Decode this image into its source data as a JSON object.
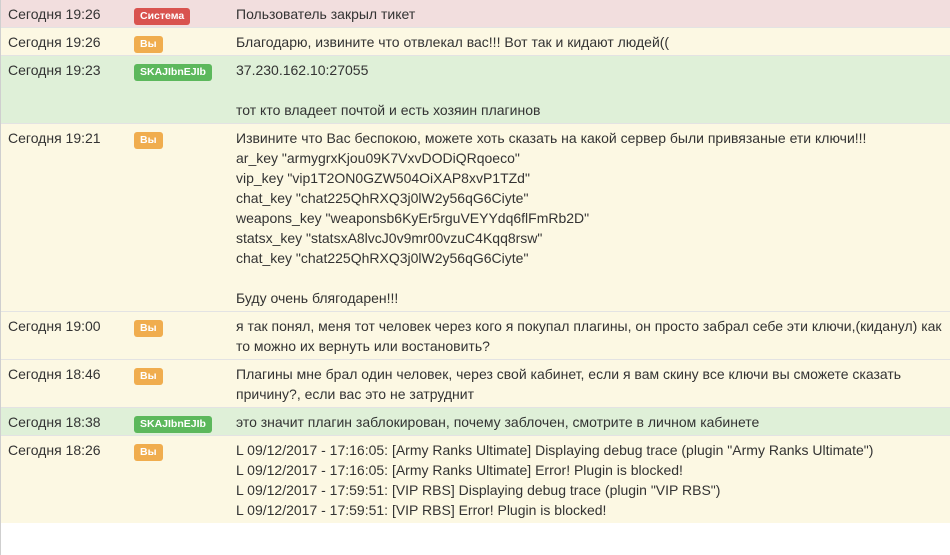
{
  "messages": [
    {
      "time": "Сегодня 19:26",
      "author": "Система",
      "role": "system",
      "lines": [
        "Пользователь закрыл тикет"
      ]
    },
    {
      "time": "Сегодня 19:26",
      "author": "Вы",
      "role": "user",
      "lines": [
        "Благодарю, извините что отвлекал вас!!! Вот так и кидают людей(("
      ]
    },
    {
      "time": "Сегодня 19:23",
      "author": "SKAJIbnEJIb",
      "role": "staff",
      "lines": [
        "37.230.162.10:27055",
        "",
        "тот кто владеет почтой и есть хозяин плагинов"
      ]
    },
    {
      "time": "Сегодня 19:21",
      "author": "Вы",
      "role": "user",
      "lines": [
        "Извините что Вас беспокою, можете хоть сказать на какой сервер были привязаные ети ключи!!!",
        "ar_key \"armygrxKjou09K7VxvDODiQRqoeco\"",
        "vip_key \"vip1T2ON0GZW504OiXAP8xvP1TZd\"",
        "chat_key \"chat225QhRXQ3j0lW2y56qG6Ciyte\"",
        "weapons_key \"weaponsb6KyEr5rguVEYYdq6flFmRb2D\"",
        "statsx_key \"statsxA8lvcJ0v9mr00vzuC4Kqq8rsw\"",
        "chat_key \"chat225QhRXQ3j0lW2y56qG6Ciyte\"",
        "",
        "Буду очень блягодарен!!!"
      ]
    },
    {
      "time": "Сегодня 19:00",
      "author": "Вы",
      "role": "user",
      "lines": [
        "я так понял, меня тот человек через кого я покупал плагины, он просто забрал себе эти ключи,(киданул) как",
        "то можно их вернуть или востановить?"
      ]
    },
    {
      "time": "Сегодня 18:46",
      "author": "Вы",
      "role": "user",
      "lines": [
        "Плагины мне брал один человек, через свой кабинет, если я вам скину все ключи вы сможете сказать",
        "причину?, если вас это не затруднит"
      ]
    },
    {
      "time": "Сегодня 18:38",
      "author": "SKAJIbnEJIb",
      "role": "staff",
      "lines": [
        "это значит плагин заблокирован, почему заблочен, смотрите в личном кабинете"
      ]
    },
    {
      "time": "Сегодня 18:26",
      "author": "Вы",
      "role": "user",
      "lines": [
        "L 09/12/2017 - 17:16:05: [Army Ranks Ultimate] Displaying debug trace (plugin \"Army Ranks Ultimate\")",
        "L 09/12/2017 - 17:16:05: [Army Ranks Ultimate] Error! Plugin is blocked!",
        "L 09/12/2017 - 17:59:51: [VIP RBS] Displaying debug trace (plugin \"VIP RBS\")",
        "L 09/12/2017 - 17:59:51: [VIP RBS] Error! Plugin is blocked!"
      ]
    }
  ]
}
